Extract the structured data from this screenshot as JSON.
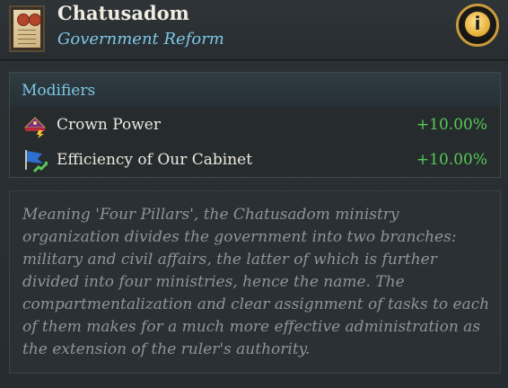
{
  "header": {
    "title": "Chatusadom",
    "subtitle": "Government Reform",
    "icon": "reform-document-icon",
    "info_button_icon": "info-icon",
    "info_glyph": "i"
  },
  "modifiers": {
    "heading": "Modifiers",
    "items": [
      {
        "label": "Crown Power",
        "value": "+10.00%",
        "icon": "crown-power-icon"
      },
      {
        "label": "Efficiency of Our Cabinet",
        "value": "+10.00%",
        "icon": "cabinet-efficiency-icon"
      }
    ],
    "value_color": "#57c957"
  },
  "description": {
    "text": "Meaning 'Four Pillars', the Chatusadom ministry organization divides the government into two branches: military and civil affairs, the latter of which is further divided into four ministries, hence the name. The compartmentalization and clear assignment of tasks to each of them makes for a much more effective administration as the extension of the ruler's authority."
  },
  "colors": {
    "accent": "#7ec7e7",
    "positive": "#57c957",
    "gold": "#c99a3c"
  }
}
